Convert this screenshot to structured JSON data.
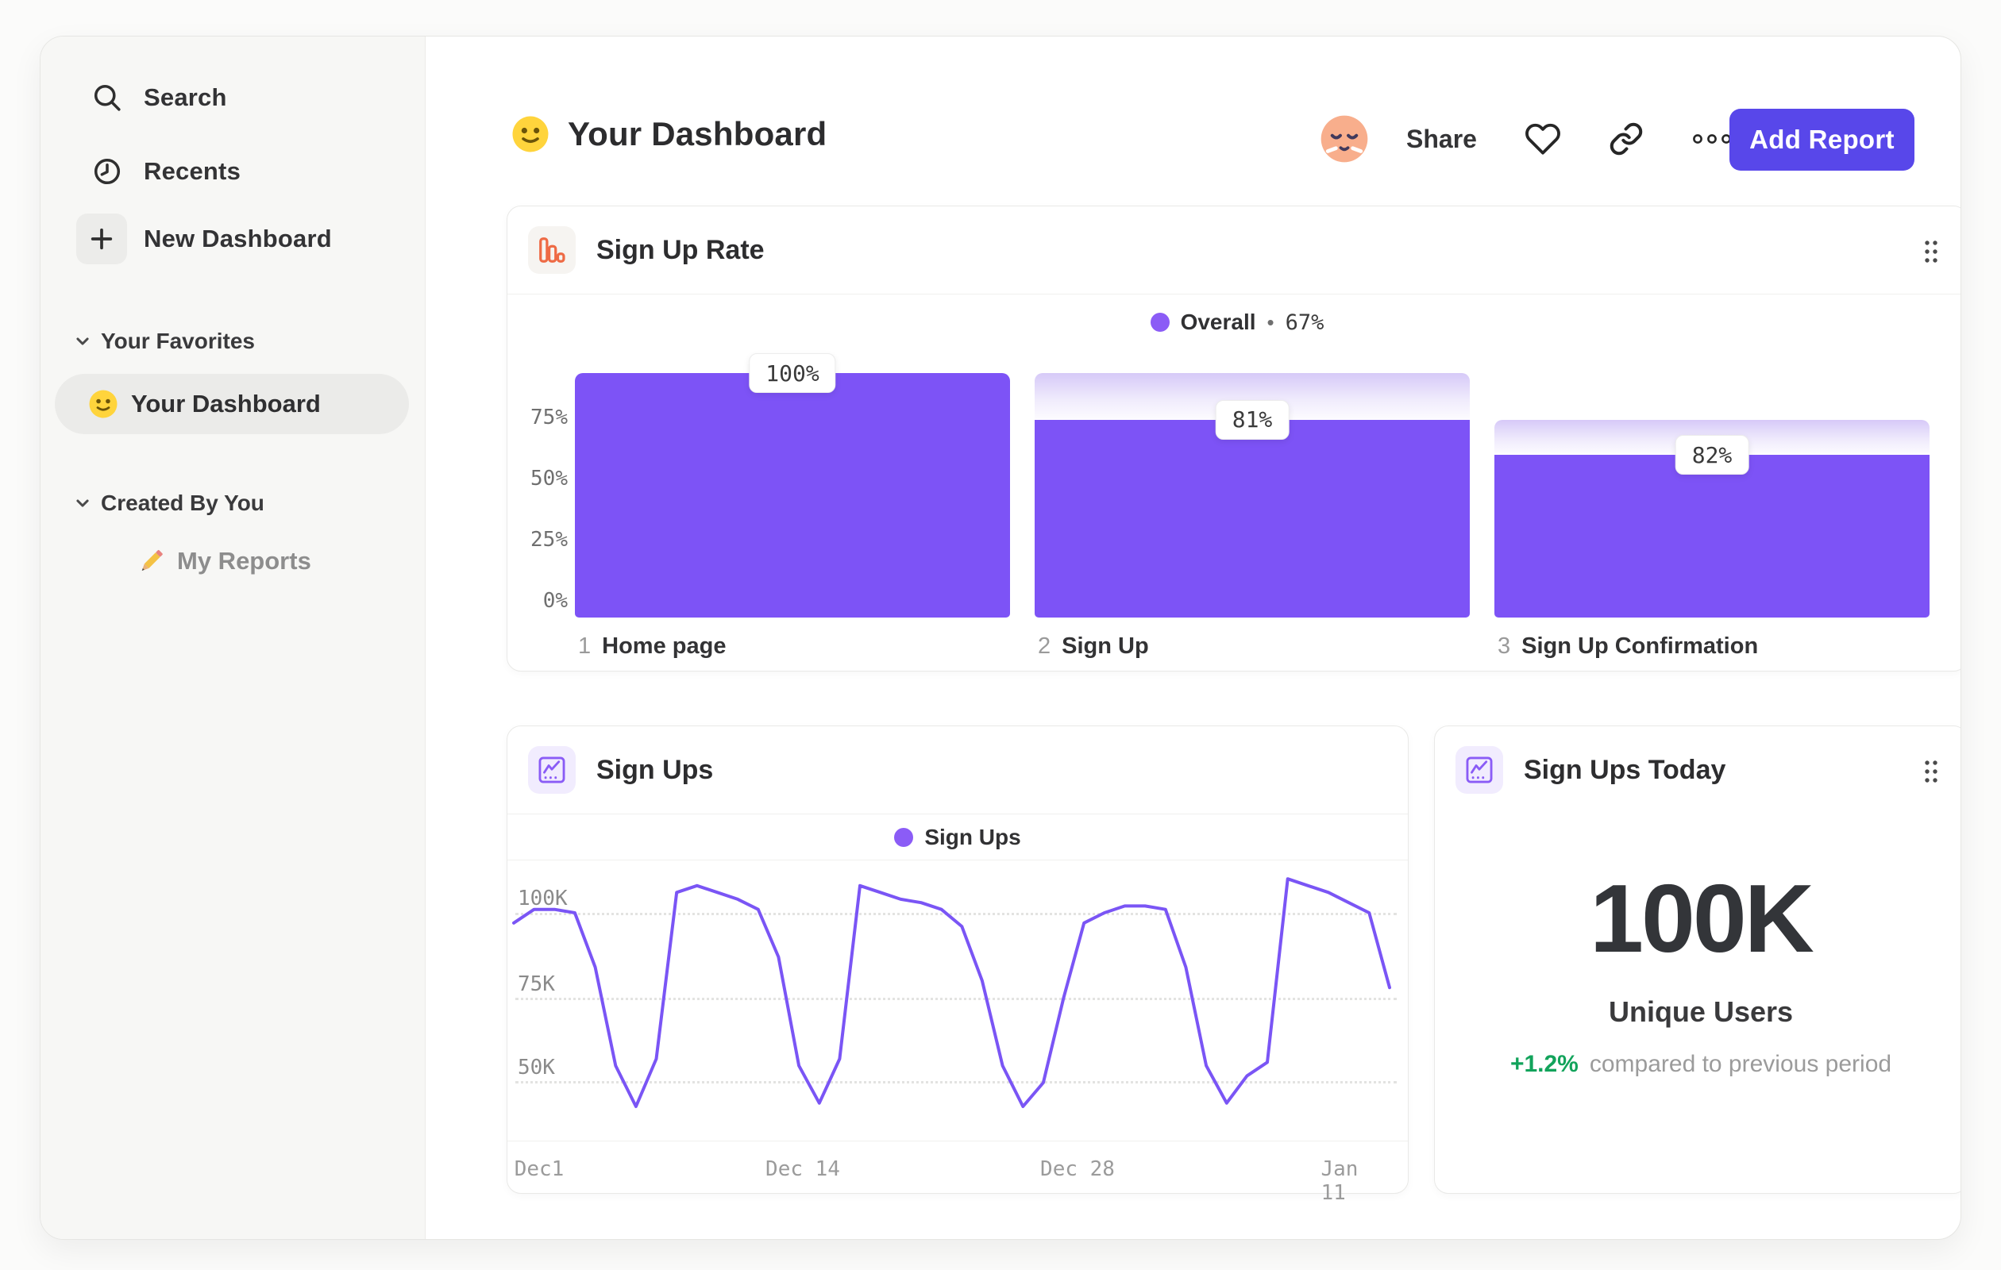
{
  "sidebar": {
    "nav": [
      {
        "icon": "search-icon",
        "label": "Search"
      },
      {
        "icon": "clock-icon",
        "label": "Recents"
      },
      {
        "icon": "plus-icon",
        "label": "New Dashboard"
      }
    ],
    "sections": [
      {
        "title": "Your Favorites",
        "items": [
          {
            "icon": "smiley-emoji",
            "label": "Your Dashboard",
            "selected": true
          }
        ]
      },
      {
        "title": "Created By You",
        "items": [
          {
            "icon": "pencil-emoji",
            "label": "My Reports",
            "selected": false
          }
        ]
      }
    ]
  },
  "header": {
    "title": "Your Dashboard",
    "share": "Share",
    "add_report": "Add Report"
  },
  "funnel_card": {
    "title": "Sign Up Rate",
    "legend": {
      "series": "Overall",
      "sep": "•",
      "value": "67%"
    },
    "y_ticks": [
      "75%",
      "50%",
      "25%",
      "0%"
    ],
    "steps": [
      {
        "num": "1",
        "name": "Home page",
        "chip": "100%"
      },
      {
        "num": "2",
        "name": "Sign Up",
        "chip": "81%"
      },
      {
        "num": "3",
        "name": "Sign Up Confirmation",
        "chip": "82%"
      }
    ]
  },
  "line_card": {
    "title": "Sign Ups",
    "legend": "Sign Ups",
    "y_ticks": [
      "100K",
      "75K",
      "50K"
    ],
    "x_ticks": [
      "Dec1",
      "Dec 14",
      "Dec 28",
      "Jan 11"
    ]
  },
  "metric_card": {
    "title": "Sign Ups Today",
    "value": "100K",
    "unit_label": "Unique Users",
    "delta": "+1.2%",
    "delta_caption": "compared to previous period"
  },
  "colors": {
    "bar_purple": "#7d53f6",
    "line_purple": "#7a55f5",
    "legend_dot_purple": "#8b5cf6",
    "button_purple": "#5847ea",
    "delta_green": "#12a35b",
    "funnel_icon_orange": "#ee6a45",
    "sidebar_bg": "#f7f7f5"
  },
  "chart_data": [
    {
      "type": "bar",
      "variant": "funnel",
      "title": "Sign Up Rate",
      "legend": "Overall",
      "overall_conversion_pct": 67,
      "categories": [
        "1 Home page",
        "2 Sign Up",
        "3 Sign Up Confirmation"
      ],
      "values_pct_of_previous": [
        100,
        81,
        82
      ],
      "values_pct_overall": [
        100,
        81,
        66.5
      ],
      "ylabel_ticks": [
        "0%",
        "25%",
        "50%",
        "75%"
      ],
      "ylim": [
        0,
        100
      ],
      "legend_position": "top-center"
    },
    {
      "type": "line",
      "title": "Sign Ups",
      "x_ticks": [
        "Dec1",
        "Dec 14",
        "Dec 28",
        "Jan 11"
      ],
      "y_unit": "K",
      "y_ticks": [
        50,
        75,
        100
      ],
      "ylim_k": [
        30,
        115
      ],
      "grid": "dotted-horizontal",
      "legend_position": "top-center",
      "series": [
        {
          "name": "Sign Ups",
          "values_k": [
            97,
            101,
            101,
            100,
            84,
            55,
            43,
            57,
            106,
            108,
            106,
            104,
            101,
            87,
            55,
            44,
            57,
            108,
            106,
            104,
            103,
            101,
            96,
            80,
            55,
            43,
            50,
            75,
            97,
            100,
            102,
            102,
            101,
            84,
            55,
            44,
            52,
            56,
            110,
            108,
            106,
            103,
            100,
            78
          ]
        }
      ]
    },
    {
      "type": "metric",
      "title": "Sign Ups Today",
      "value": "100K",
      "label": "Unique Users",
      "delta_pct": 1.2,
      "caption": "compared to previous period"
    }
  ]
}
